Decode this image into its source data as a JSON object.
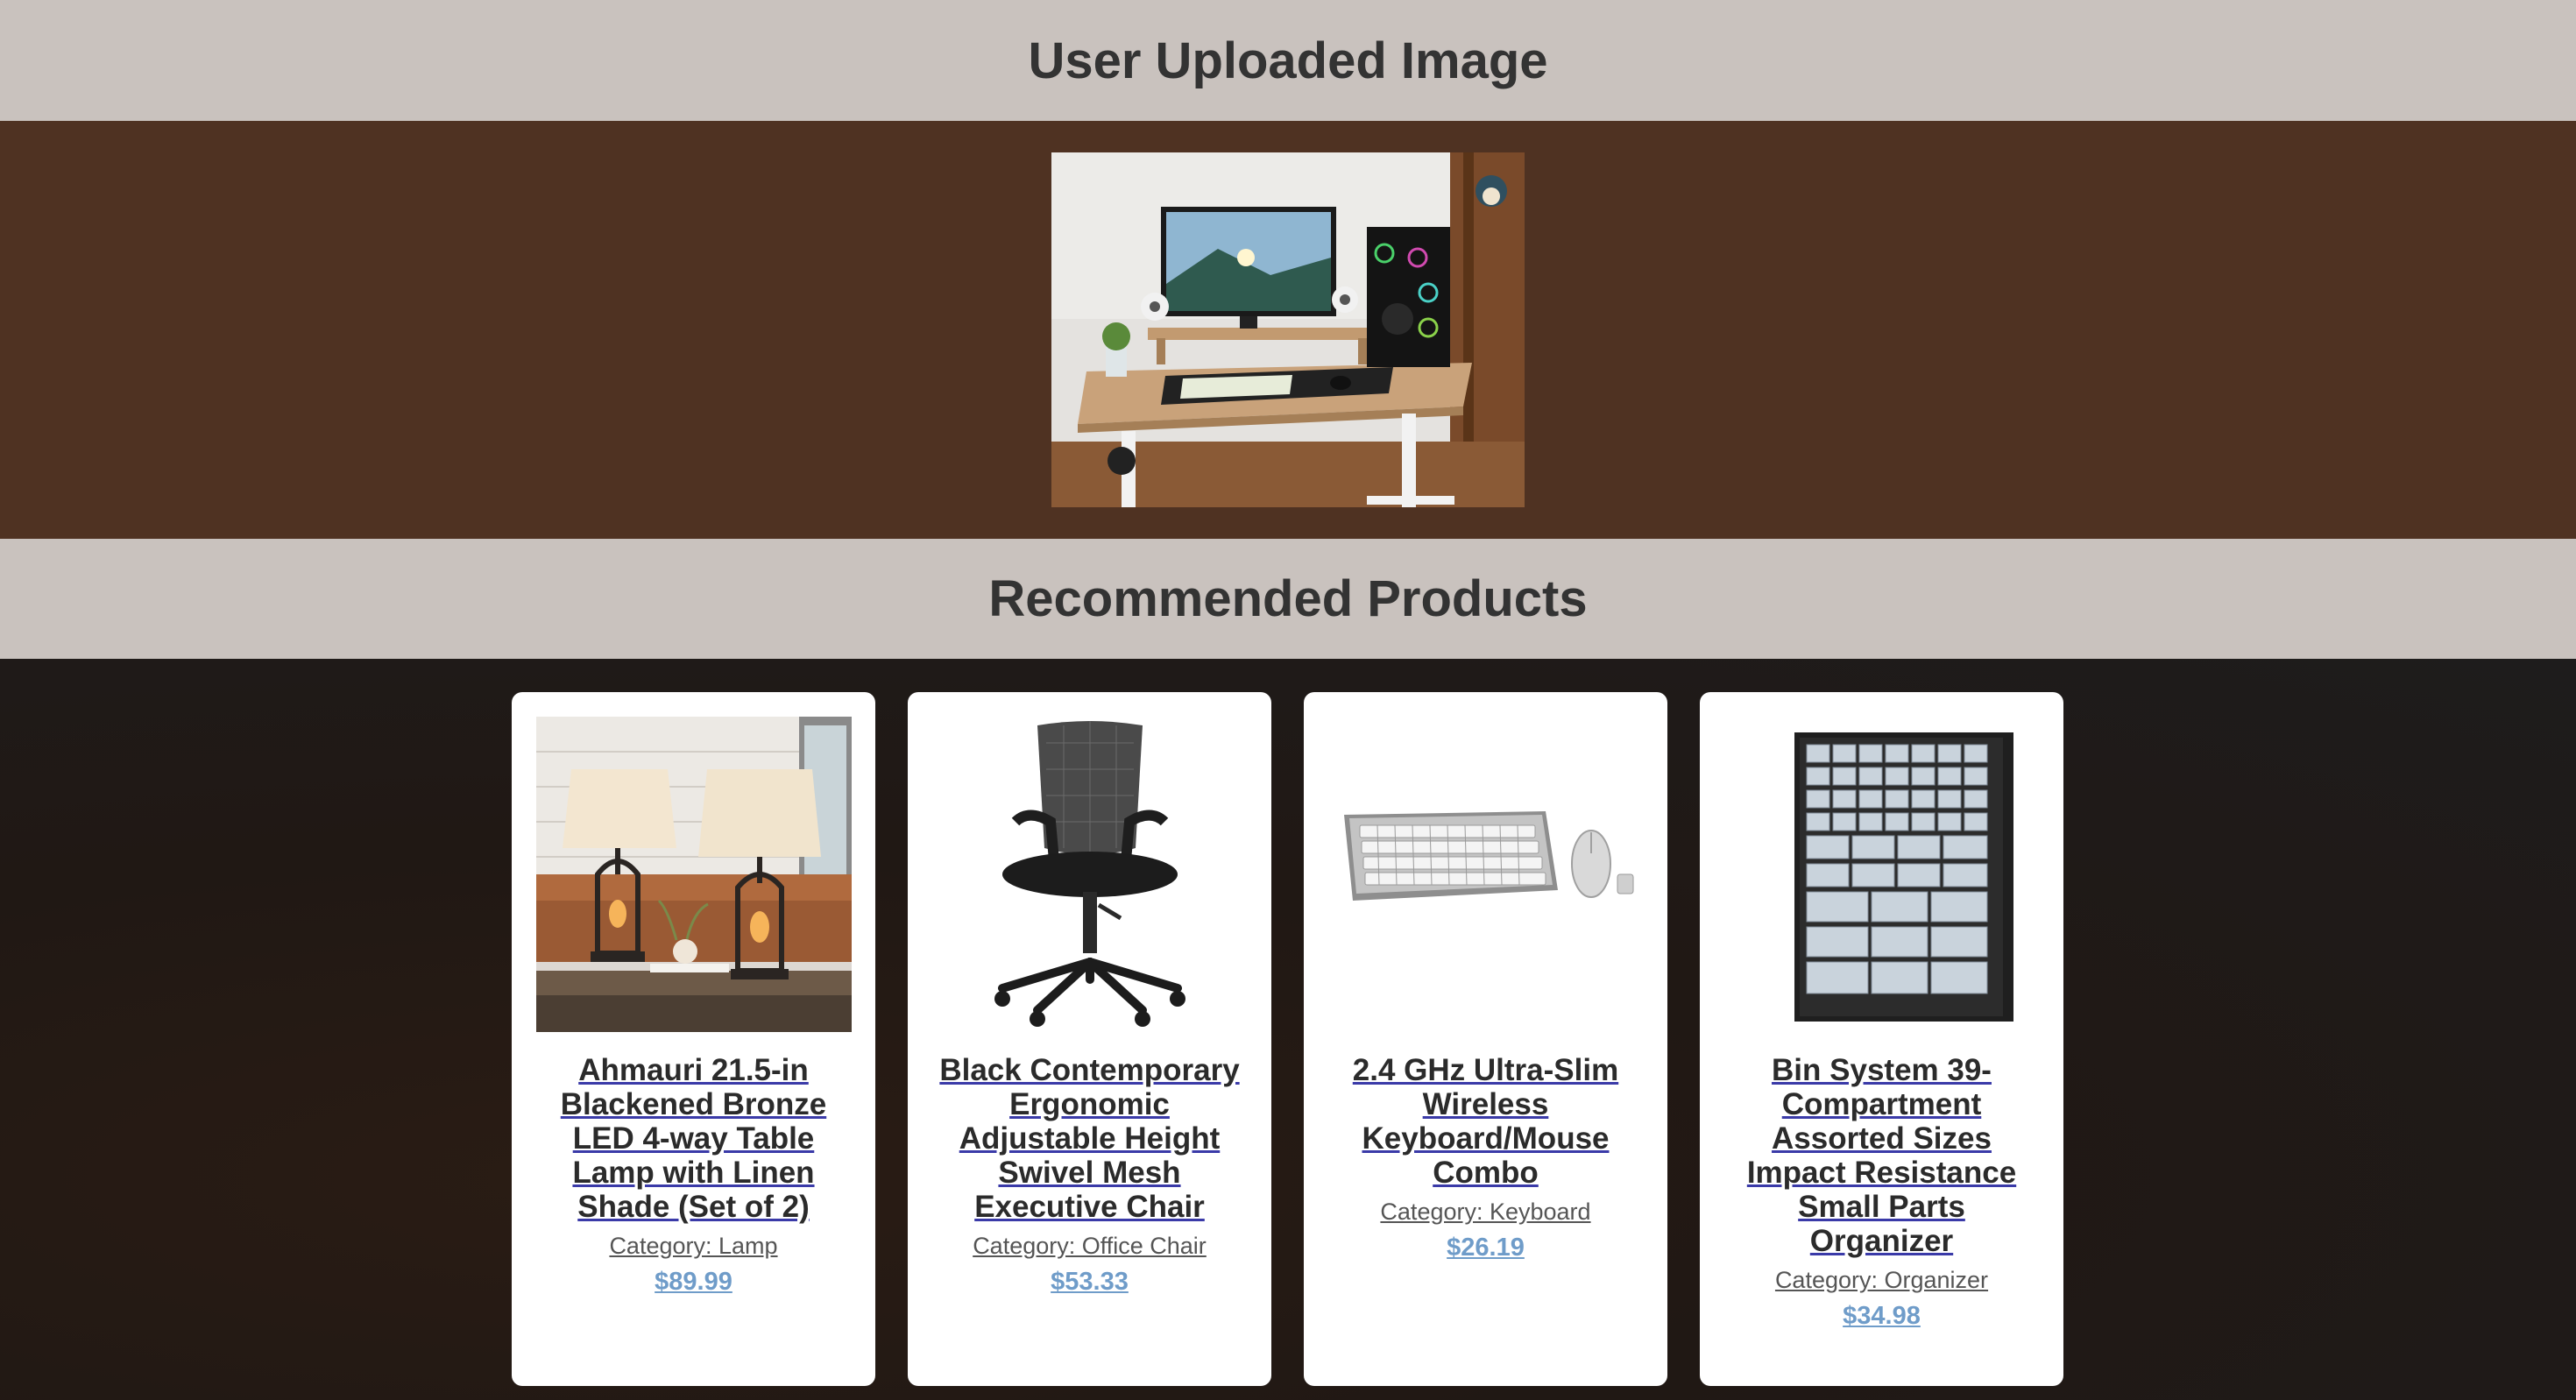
{
  "headers": {
    "upload_title": "User Uploaded Image",
    "recommended_title": "Recommended Products"
  },
  "uploaded_image": {
    "icon": "desk-setup-photo"
  },
  "products": [
    {
      "title": "Ahmauri 21.5-in Blackened Bronze LED 4-way Table Lamp with Linen Shade (Set of 2)",
      "category": "Category: Lamp",
      "price": "$89.99",
      "icon": "table-lamp-image"
    },
    {
      "title": "Black Contemporary Ergonomic Adjustable Height Swivel Mesh Executive Chair",
      "category": "Category: Office Chair",
      "price": "$53.33",
      "icon": "office-chair-image"
    },
    {
      "title": "2.4 GHz Ultra-Slim Wireless Keyboard/Mouse Combo",
      "category": "Category: Keyboard",
      "price": "$26.19",
      "icon": "keyboard-mouse-image"
    },
    {
      "title": "Bin System 39-Compartment Assorted Sizes Impact Resistance Small Parts Organizer",
      "category": "Category: Organizer",
      "price": "$34.98",
      "icon": "parts-organizer-image"
    }
  ],
  "colors": {
    "header_band": "#c9c2be",
    "upload_band": "#4f3222",
    "price": "#6f9cc9"
  }
}
